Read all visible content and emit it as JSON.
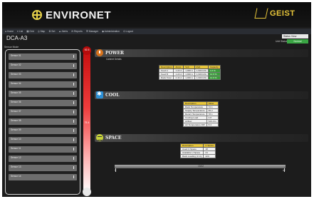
{
  "brand": {
    "name": "ENVIRONET",
    "partner": "GEIST"
  },
  "nav": {
    "items": [
      "● Home",
      "≡ List",
      "▦ Grid",
      "◎ Map",
      "⚙ Set",
      "▲ Alerts",
      "✉ Reports",
      "☰ Manager",
      "◆ Administration",
      "⏻ Logout"
    ]
  },
  "page": {
    "title": "DCA-A3",
    "status_select": "Status View",
    "alert_label": "Unit Status",
    "alert_badge": "Normal"
  },
  "sensor_list": {
    "label": "Sensor Mode",
    "items": [
      "Sensor 01",
      "Sensor 02",
      "Sensor 03",
      "Sensor 04",
      "Sensor 05",
      "Sensor 06",
      "Sensor 07",
      "Sensor 08",
      "Sensor 09",
      "Sensor 10",
      "Sensor 11",
      "Sensor 12",
      "Sensor 13",
      "Sensor 14"
    ]
  },
  "thermometer": {
    "top": "92.5",
    "mid": "75.4",
    "level": 0.82
  },
  "power": {
    "title": "POWER",
    "subtitle": "Cabinet Details",
    "headers": [
      "Description",
      "Amps",
      "Volt",
      "kVA",
      "Capacity"
    ],
    "rows": [
      [
        "Feed A",
        "1.22 A",
        "1,900 A",
        "1,900 kVA",
        "4.3 %"
      ],
      [
        "Feed B",
        "1.22 A",
        "1,900 A",
        "1,900 kVA",
        "12.9 %"
      ],
      [
        "Rack Total",
        "2.44 A",
        "1,900 A",
        "1,900 kVA",
        "12.9 %"
      ]
    ]
  },
  "cool": {
    "title": "COOL",
    "headers": [
      "Description",
      "Value"
    ],
    "rows": [
      [
        "Rack Temperature",
        "72.1"
      ],
      [
        "Supply Temperature",
        "65.2"
      ],
      [
        "Return Temperature",
        "78.1"
      ],
      [
        "Cooling Load",
        "4.8"
      ],
      [
        "Airflow",
        "520 cfm"
      ],
      [
        "Air Temperature Diff",
        "8.4"
      ]
    ]
  },
  "space": {
    "title": "SPACE",
    "headers": [
      "Description",
      "U Space"
    ],
    "rows": [
      [
        "Used U Space",
        "18"
      ],
      [
        "Available U Space",
        "24"
      ],
      [
        "Rack Loading (U in)",
        "42U"
      ]
    ]
  },
  "scale": {
    "label": "19/42",
    "start": "0",
    "end": "42"
  }
}
